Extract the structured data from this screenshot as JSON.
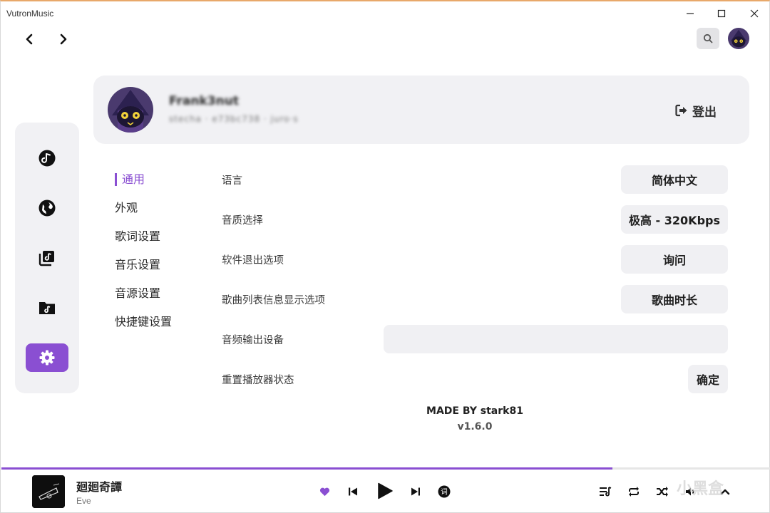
{
  "window": {
    "title": "VutronMusic"
  },
  "profile": {
    "name": "Frank3nut",
    "subtitle": "stecha · e73bc738 · juro·s",
    "logout_label": "登出"
  },
  "settings_tabs": [
    {
      "label": "通用",
      "active": true
    },
    {
      "label": "外观",
      "active": false
    },
    {
      "label": "歌词设置",
      "active": false
    },
    {
      "label": "音乐设置",
      "active": false
    },
    {
      "label": "音源设置",
      "active": false
    },
    {
      "label": "快捷键设置",
      "active": false
    }
  ],
  "settings": {
    "language": {
      "label": "语言",
      "value": "简体中文"
    },
    "quality": {
      "label": "音质选择",
      "value": "极高 - 320Kbps"
    },
    "exit_option": {
      "label": "软件退出选项",
      "value": "询问"
    },
    "list_info": {
      "label": "歌曲列表信息显示选项",
      "value": "歌曲时长"
    },
    "output_device": {
      "label": "音频输出设备",
      "value": ""
    },
    "reset": {
      "label": "重置播放器状态",
      "value": "确定"
    }
  },
  "footer": {
    "made_by": "MADE BY stark81",
    "version": "v1.6.0"
  },
  "player": {
    "title": "廻廻奇譚",
    "artist": "Eve",
    "progress": 0.795,
    "lyrics_icon_text": "词"
  },
  "watermark": "小黑盒",
  "colors": {
    "accent": "#8a4fd2",
    "card_bg": "#f1f1f4",
    "button_bg": "#f0f0f3"
  },
  "icons": {
    "sidebar": [
      "music-note-icon",
      "globe-icon",
      "library-icon",
      "folder-music-icon",
      "settings-gear-icon"
    ],
    "player": [
      "heart-icon",
      "previous-icon",
      "play-icon",
      "next-icon",
      "lyrics-icon",
      "playlist-icon",
      "repeat-icon",
      "shuffle-icon",
      "volume-icon",
      "chevron-up-icon"
    ]
  }
}
